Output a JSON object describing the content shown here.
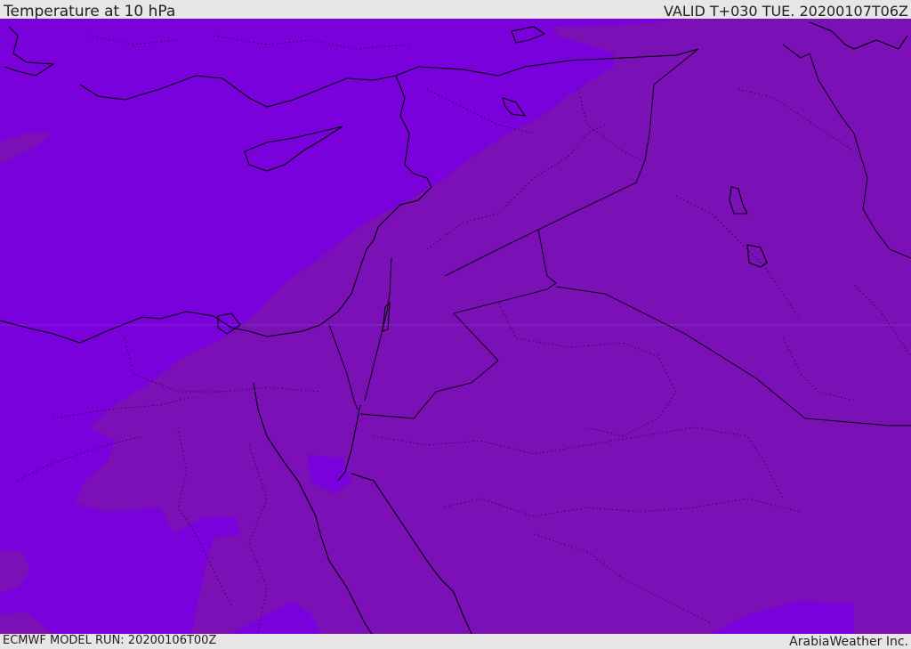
{
  "header": {
    "title": "Temperature at 10 hPa",
    "valid": "VALID T+030 TUE. 20200107T06Z"
  },
  "footer": {
    "model_run": "ECMWF MODEL RUN: 20200106T00Z",
    "credit": "ArabiaWeather Inc."
  },
  "colors": {
    "cold_band": "#7a00dc",
    "warm_band": "#7a10b6",
    "coastline": "#000000",
    "borders": "#000000"
  }
}
